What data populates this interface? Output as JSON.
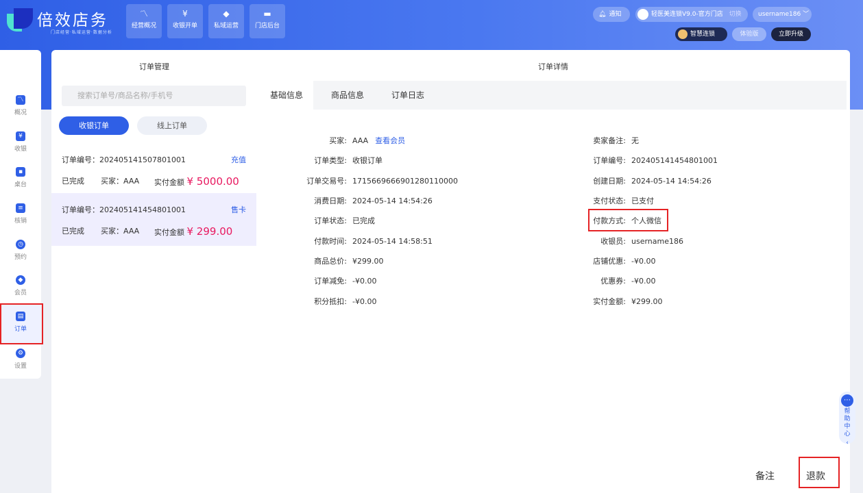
{
  "app": {
    "logo_title": "倍效店务",
    "logo_sub": "门店经营·私域运营·数据分析"
  },
  "topnav": [
    {
      "label": "经营概况",
      "icon": "trend-icon"
    },
    {
      "label": "收银开单",
      "icon": "yen-icon"
    },
    {
      "label": "私域运营",
      "icon": "diamond-icon"
    },
    {
      "label": "门店后台",
      "icon": "card-icon"
    }
  ],
  "topbar_right": {
    "notify": "通知",
    "store": "轻医美连锁V9.0-官方门店",
    "switch": "切换",
    "username": "username186",
    "smart_chain": "智慧连锁",
    "trial": "体验版",
    "upgrade": "立即升级"
  },
  "sidebar": [
    {
      "label": "概况",
      "icon": "chart-icon"
    },
    {
      "label": "收银",
      "icon": "yen-icon"
    },
    {
      "label": "桌台",
      "icon": "table-icon"
    },
    {
      "label": "核销",
      "icon": "verify-icon"
    },
    {
      "label": "预约",
      "icon": "clock-icon"
    },
    {
      "label": "会员",
      "icon": "diamond-icon"
    },
    {
      "label": "订单",
      "icon": "clipboard-icon"
    },
    {
      "label": "设置",
      "icon": "gear-icon"
    }
  ],
  "order_mgmt": {
    "title": "订单管理",
    "search_placeholder": "搜索订单号/商品名称/手机号",
    "tabs": [
      "收银订单",
      "线上订单"
    ],
    "orders": [
      {
        "no": "订单编号：202405141507801001",
        "tag": "充值",
        "status": "已完成",
        "buyer": "买家：AAA",
        "amount_label": "实付金额",
        "amount": "¥ 5000.00"
      },
      {
        "no": "订单编号：202405141454801001",
        "tag": "售卡",
        "status": "已完成",
        "buyer": "买家：AAA",
        "amount_label": "实付金额",
        "amount": "¥ 299.00"
      }
    ]
  },
  "detail": {
    "title": "订单详情",
    "tabs": [
      "基础信息",
      "商品信息",
      "订单日志"
    ],
    "view_member": "查看会员",
    "left": [
      {
        "k": "买家:",
        "v": "AAA"
      },
      {
        "k": "订单类型:",
        "v": "收银订单"
      },
      {
        "k": "订单交易号:",
        "v": "1715669666901280110000"
      },
      {
        "k": "消费日期:",
        "v": "2024-05-14 14:54:26"
      },
      {
        "k": "订单状态:",
        "v": "已完成"
      },
      {
        "k": "付款时间:",
        "v": "2024-05-14 14:58:51"
      },
      {
        "k": "商品总价:",
        "v": "¥299.00"
      },
      {
        "k": "订单减免:",
        "v": "-¥0.00"
      },
      {
        "k": "积分抵扣:",
        "v": "-¥0.00"
      }
    ],
    "right": [
      {
        "k": "卖家备注:",
        "v": "无"
      },
      {
        "k": "订单编号:",
        "v": "202405141454801001"
      },
      {
        "k": "创建日期:",
        "v": "2024-05-14 14:54:26"
      },
      {
        "k": "支付状态:",
        "v": "已支付"
      },
      {
        "k": "付款方式:",
        "v": "个人微信"
      },
      {
        "k": "收银员:",
        "v": "username186"
      },
      {
        "k": "店铺优惠:",
        "v": "-¥0.00"
      },
      {
        "k": "优惠券:",
        "v": "-¥0.00"
      },
      {
        "k": "实付金额:",
        "v": "¥299.00"
      }
    ]
  },
  "help": {
    "label": "帮助中心"
  },
  "footer": {
    "note": "备注",
    "refund": "退款"
  }
}
